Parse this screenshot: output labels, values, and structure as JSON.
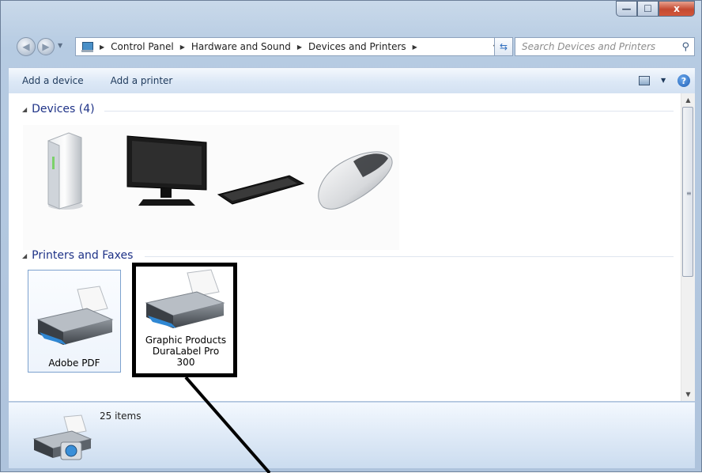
{
  "window": {
    "caption_buttons": {
      "min": "—",
      "max": "☐",
      "close": "x"
    }
  },
  "address": {
    "breadcrumbs": [
      "Control Panel",
      "Hardware and Sound",
      "Devices and Printers"
    ],
    "search_placeholder": "Search Devices and Printers"
  },
  "toolbar": {
    "add_device": "Add a device",
    "add_printer": "Add a printer",
    "help": "?"
  },
  "groups": {
    "devices_header": "Devices (4)",
    "printers_header": "Printers and Faxes"
  },
  "devices": [
    {
      "icon": "external-drive-icon"
    },
    {
      "icon": "monitor-icon"
    },
    {
      "icon": "keyboard-icon"
    },
    {
      "icon": "mouse-icon"
    }
  ],
  "printers": [
    {
      "label": "Adobe PDF",
      "icon": "printer-icon",
      "selected": true
    },
    {
      "label_lines": [
        "Graphic Products",
        "DuraLabel Pro",
        "300"
      ],
      "icon": "printer-icon",
      "selected": false
    }
  ],
  "details": {
    "items_count": "25 items"
  }
}
